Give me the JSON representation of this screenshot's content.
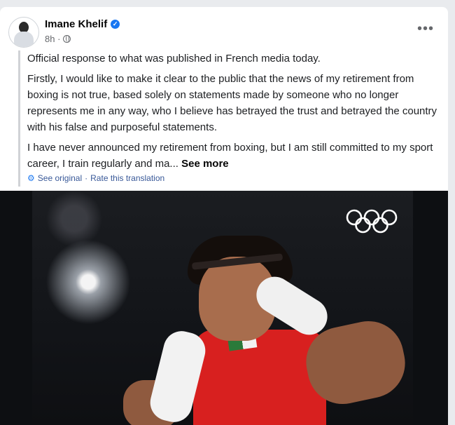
{
  "post": {
    "author": "Imane Khelif",
    "time": "8h ·",
    "more_icon": "more-horizontal-icon",
    "paragraphs": [
      "Official response to what was published in French media today.",
      "Firstly, I would like to make it clear to the public that the news of my retirement from boxing is not true, based solely on statements made by someone who no longer represents me in any way, who I believe has betrayed the trust and betrayed the country with his false and purposeful statements.",
      "I have never announced my retirement from boxing, but I am still committed to my sport career, I train regularly and ma..."
    ],
    "see_more": "See more",
    "translation": {
      "see_original": "See original",
      "separator": "·",
      "rate": "Rate this translation"
    }
  },
  "colors": {
    "accent": "#1877f2",
    "link": "#385898",
    "muted": "#65676b"
  }
}
